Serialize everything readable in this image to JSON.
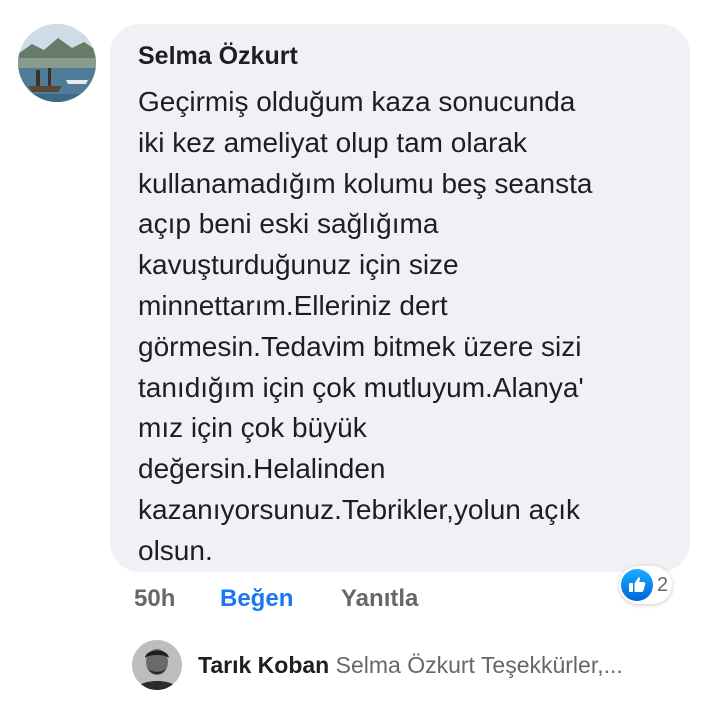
{
  "comment": {
    "author": "Selma Özkurt",
    "text": "Geçirmiş olduğum kaza sonucunda\niki kez ameliyat olup tam olarak\nkullanamadığım kolumu beş seansta\naçıp beni eski sağlığıma\nkavuşturduğunuz için size\nminnettarım.Elleriniz dert\ngörmesin.Tedavim bitmek üzere sizi\ntanıdığım için çok mutluyum.Alanya'\nmız için çok büyük\ndeğersin.Helalinden\nkazanıyorsunuz.Tebrikler,yolun açık\nolsun.",
    "time": "50h",
    "like_label": "Beğen",
    "reply_label": "Yanıtla",
    "reaction_count": "2",
    "reaction_icon": "like-thumb-icon"
  },
  "reply": {
    "author": "Tarık Koban",
    "preview": "Selma Özkurt Teşekkürler,..."
  },
  "colors": {
    "bubble": "#eff1f4",
    "accent": "#1877f2",
    "muted": "#65676b",
    "text": "#1c1e21"
  }
}
